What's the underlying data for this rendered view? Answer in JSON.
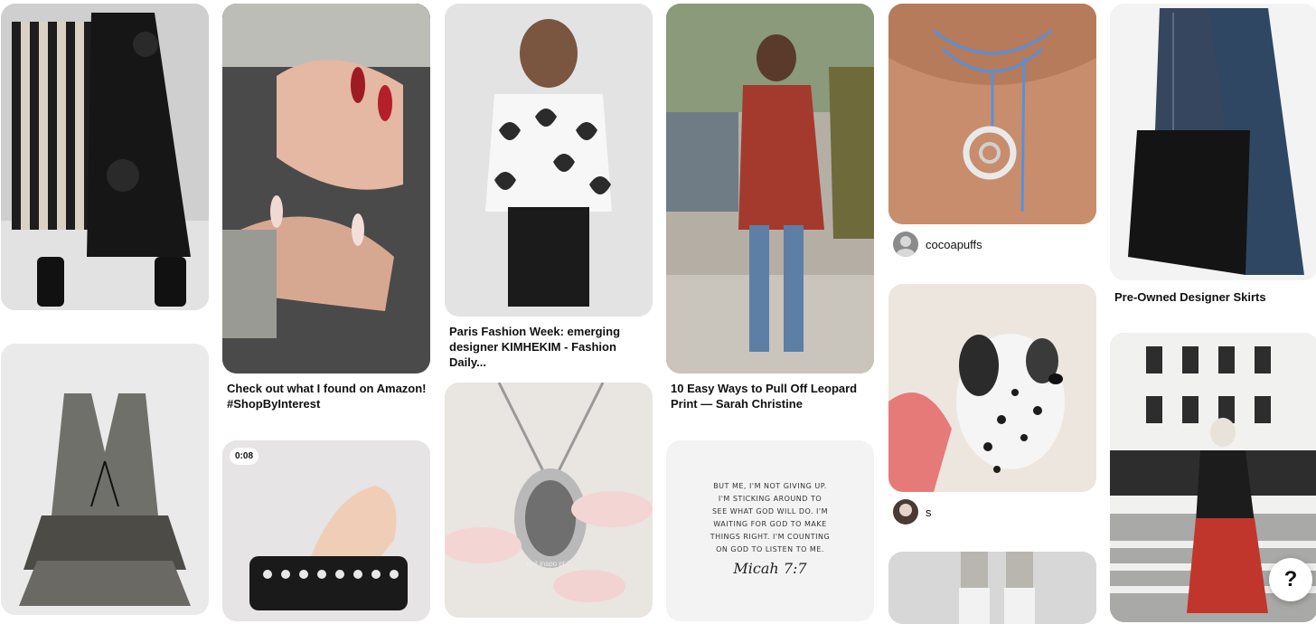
{
  "pins": {
    "striped_skirt": {
      "icon": "pin-image"
    },
    "nails": {
      "caption": "Check out what I found on Amazon! #ShopByInterest"
    },
    "paris": {
      "caption": "Paris Fashion Week: emerging designer KIMHEKIM - Fashion Daily..."
    },
    "street": {
      "caption": "10 Easy Ways to Pull Off Leopard Print — Sarah Christine"
    },
    "necklace": {
      "author": "cocoapuffs"
    },
    "denim_skirt": {
      "caption": "Pre-Owned Designer Skirts"
    },
    "vest": {
      "icon": "pin-image"
    },
    "bracelet": {
      "duration": "0:08"
    },
    "pendant": {
      "overlay": "nail inspo pt:7"
    },
    "quote": {
      "text_lines": [
        "BUT ME, I'M NOT GIVING UP.",
        "I'M STICKING AROUND TO",
        "SEE WHAT GOD WILL DO. I'M",
        "WAITING FOR GOD TO MAKE",
        "THINGS RIGHT. I'M COUNTING",
        "ON GOD TO LISTEN TO ME."
      ],
      "signature": "Micah 7:7"
    },
    "dalmatian": {
      "author": "s"
    },
    "socks": {
      "icon": "pin-image"
    },
    "nyc": {
      "icon": "pin-image"
    }
  },
  "help_button": {
    "label": "?"
  },
  "colors": {
    "background": "#ffffff",
    "text": "#111111",
    "pin_placeholder": "#e9e9e9"
  }
}
